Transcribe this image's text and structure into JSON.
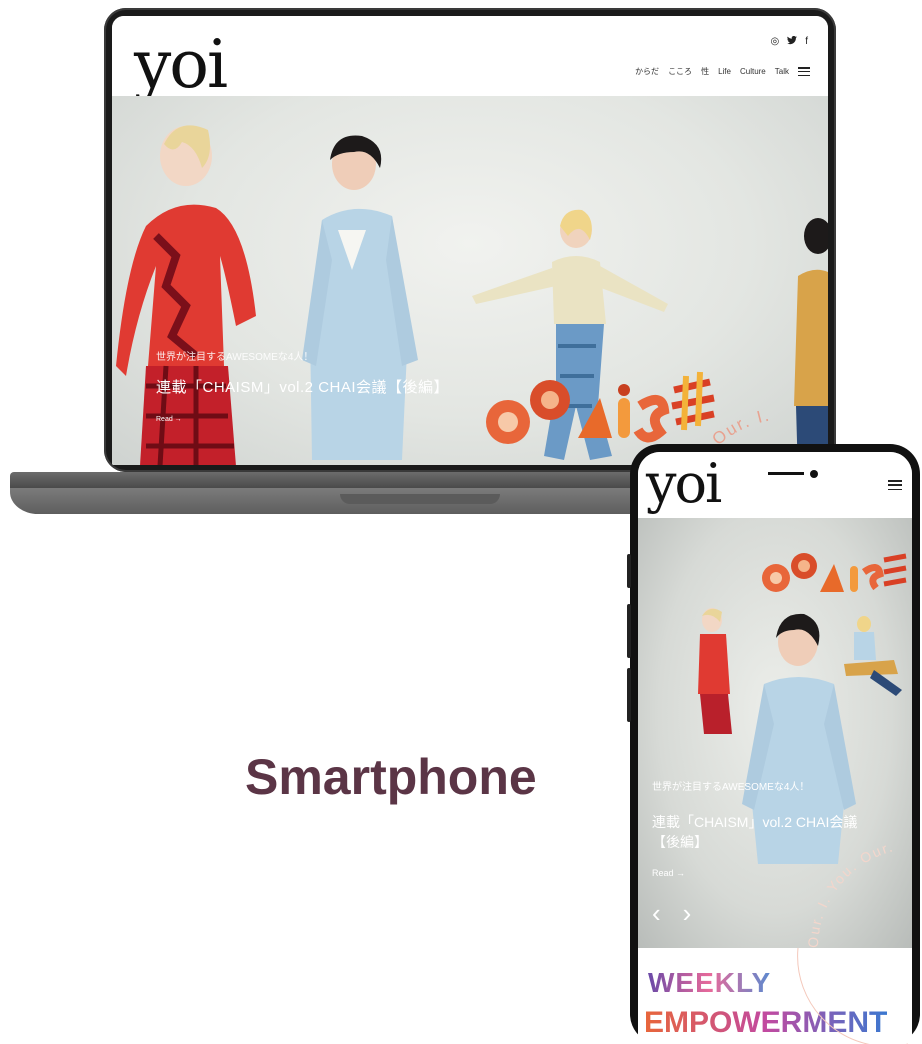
{
  "desktop": {
    "logo": "yoi",
    "social": [
      "◎",
      "🐦",
      "f"
    ],
    "nav": [
      "からだ",
      "こころ",
      "性",
      "Life",
      "Culture",
      "Talk"
    ],
    "hero": {
      "kicker": "世界が注目するAWESOMEな4人！",
      "title": "連載「CHAISM」vol.2 CHAI会議【後編】",
      "read": "Read →",
      "logo_art": "chaism",
      "ring_text": "You. Our. I."
    }
  },
  "phone": {
    "logo": "yoi",
    "hero": {
      "kicker": "世界が注目するAWESOMEな4人！",
      "title_line1": "連載「CHAISM」vol.2 CHAI会議",
      "title_line2": "【後編】",
      "read": "Read →",
      "prev": "‹",
      "next": "›",
      "ring_text": "Our. I. You. Our."
    },
    "banner": {
      "line1": "WEEKLY",
      "line2": "EMPOWERMENT"
    }
  },
  "caption": "Smartphone",
  "colors": {
    "caption": "#5b3546",
    "accent_orange": "#e8663a",
    "background": "#ffffff"
  }
}
